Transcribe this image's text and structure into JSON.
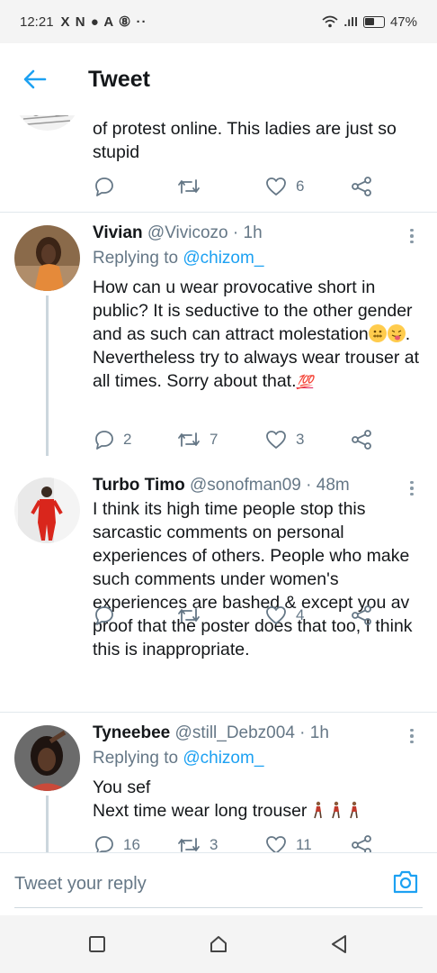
{
  "status_bar": {
    "time": "12:21",
    "indicators": "X N ● A ⑧ ··",
    "signal": ".ıll",
    "battery": "47%"
  },
  "header": {
    "title": "Tweet"
  },
  "tweets": [
    {
      "text": "of protest online. This ladies are just so stupid",
      "replies": "",
      "retweets": "",
      "likes": "6"
    },
    {
      "name": "Vivian",
      "handle": "@Vivicozo",
      "time": "· 1h",
      "replying_to_label": "Replying to",
      "replying_to": "@chizom_",
      "text": "How can u wear provocative short in public? It is seductive to the other gender and as such can attract molestation",
      "text_tail": ". Nevertheless try to always wear trouser at all times. Sorry about that.",
      "emoji_100": "💯",
      "replies": "2",
      "retweets": "7",
      "likes": "3"
    },
    {
      "name": "Turbo Timo",
      "handle": "@sonofman09",
      "time": "· 48m",
      "text": "I think its high time people stop this sarcastic comments on personal experiences of others. People who make such comments under women's experiences are bashed & except you av proof that the poster does that too, I think this is inappropriate.",
      "replies": "",
      "retweets": "",
      "likes": "4"
    },
    {
      "name": "Tyneebee",
      "handle": "@still_Debz004",
      "time": "· 1h",
      "replying_to_label": "Replying to",
      "replying_to": "@chizom_",
      "text_line1": "You sef",
      "text_line2": "Next time wear long trouser",
      "replies": "16",
      "retweets": "3",
      "likes": "11"
    }
  ],
  "composer": {
    "placeholder": "Tweet your reply"
  },
  "colors": {
    "accent": "#1da1f2",
    "secondary_text": "#657786",
    "divider": "#e1e8ed"
  }
}
